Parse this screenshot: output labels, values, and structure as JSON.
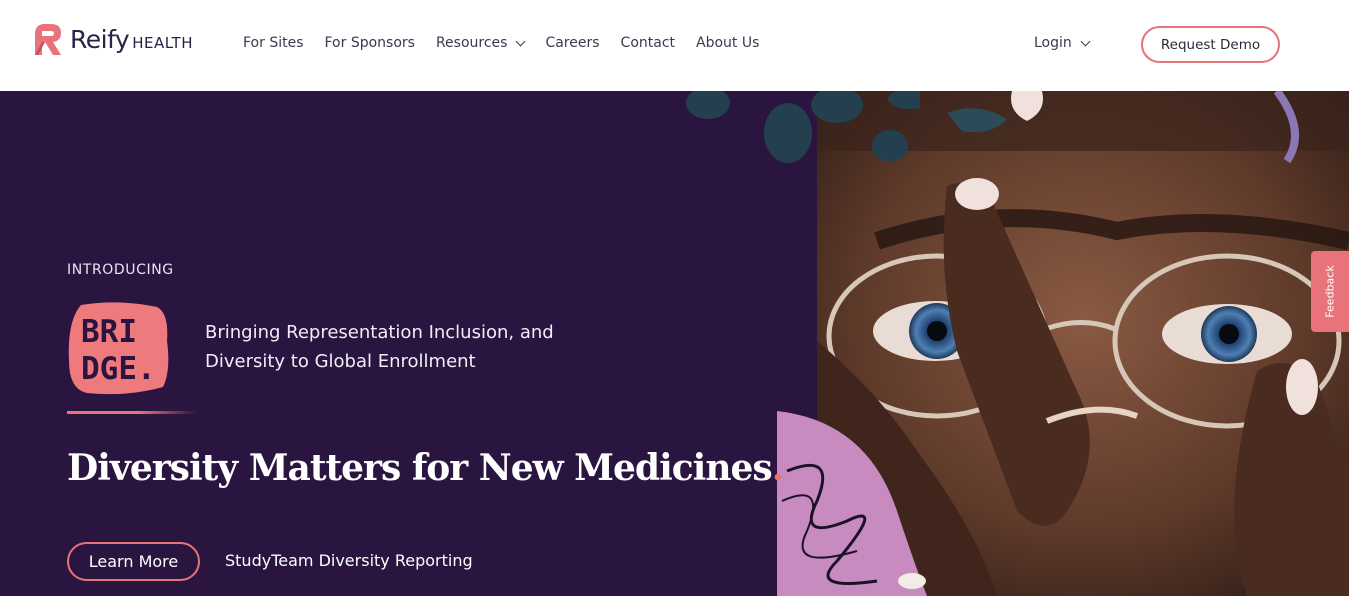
{
  "header": {
    "logo": {
      "word": "Reify",
      "sub": "HEALTH",
      "icon": "reify-r-logo-icon"
    },
    "nav": [
      {
        "label": "For Sites",
        "has_dropdown": false
      },
      {
        "label": "For Sponsors",
        "has_dropdown": false
      },
      {
        "label": "Resources",
        "has_dropdown": true
      },
      {
        "label": "Careers",
        "has_dropdown": false
      },
      {
        "label": "Contact",
        "has_dropdown": false
      },
      {
        "label": "About Us",
        "has_dropdown": false
      }
    ],
    "login_label": "Login",
    "demo_label": "Request Demo"
  },
  "hero": {
    "eyebrow": "INTRODUCING",
    "badge_lines": [
      "BRI",
      "DGE."
    ],
    "tagline_line1": "Bringing Representation Inclusion, and",
    "tagline_line2": "Diversity to Global Enrollment",
    "headline": "Diversity Matters for New Medicines",
    "headline_punct": ".",
    "cta_primary": "Learn More",
    "cta_secondary": "StudyTeam Diversity Reporting",
    "photo": "portrait-hand-over-eye-image"
  },
  "feedback_label": "Feedback",
  "colors": {
    "brand_coral": "#e8737a",
    "hero_bg": "#2a1540",
    "navy_text": "#27234a"
  }
}
